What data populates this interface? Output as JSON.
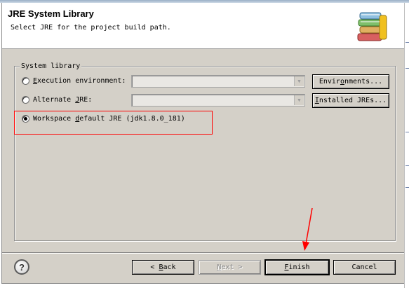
{
  "banner": {
    "title": "JRE System Library",
    "description": "Select JRE for the project build path."
  },
  "group": {
    "legend": "System library",
    "options": [
      {
        "label_pre": "",
        "mnemonic": "E",
        "label_post": "xecution environment:",
        "selected": false
      },
      {
        "label_pre": "Alternate ",
        "mnemonic": "J",
        "label_post": "RE:",
        "selected": false
      },
      {
        "label_pre": "Workspace ",
        "mnemonic": "d",
        "label_post": "efault JRE (jdk1.8.0_181)",
        "selected": true
      }
    ],
    "environments_button": {
      "pre": "Envir",
      "mnemonic": "o",
      "post": "nments..."
    },
    "installed_jres_button": {
      "pre": "",
      "mnemonic": "I",
      "post": "nstalled JREs..."
    }
  },
  "footer": {
    "help": "?",
    "back": {
      "pre": "< ",
      "mnemonic": "B",
      "post": "ack"
    },
    "next": {
      "pre": "",
      "mnemonic": "N",
      "post": "ext >"
    },
    "finish": {
      "pre": "",
      "mnemonic": "F",
      "post": "inish"
    },
    "cancel": "Cancel"
  },
  "colors": {
    "dialog_bg": "#d4d0c8",
    "annotation": "#ff0000"
  }
}
